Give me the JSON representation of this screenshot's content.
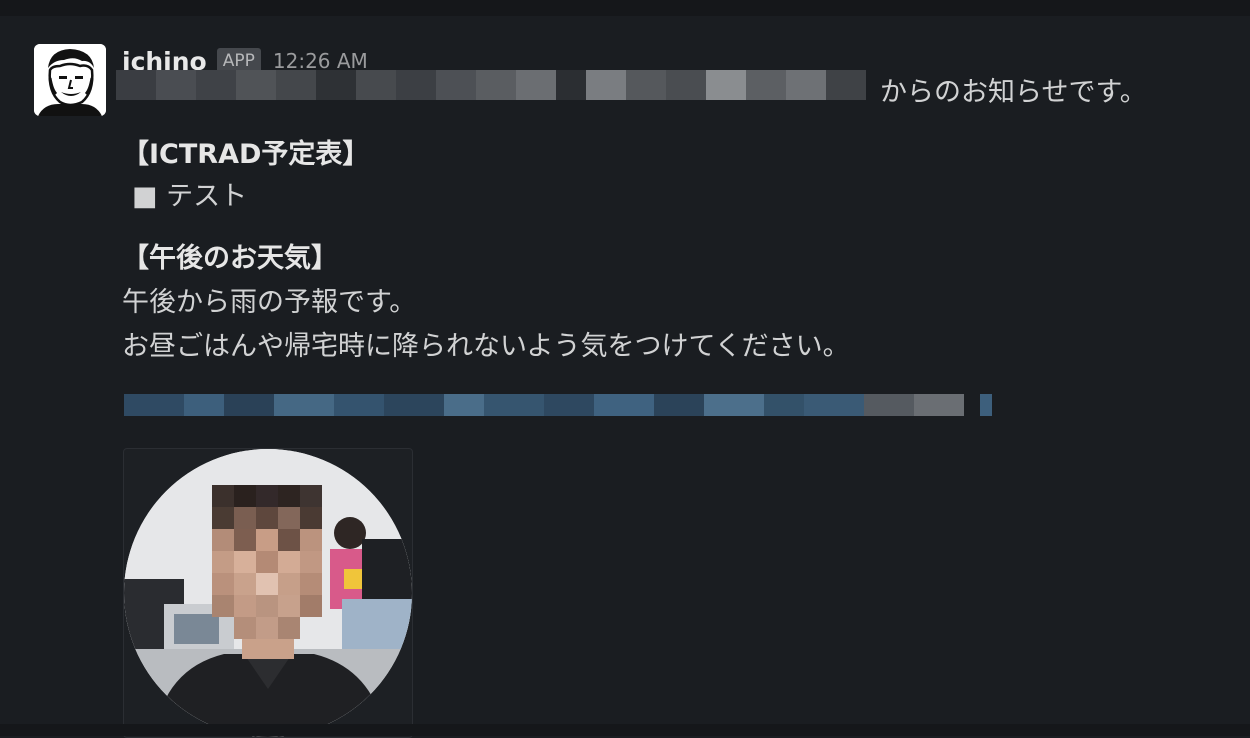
{
  "message": {
    "sender": "ichino",
    "badge": "APP",
    "timestamp": "12:26 AM",
    "intro_suffix": "からのお知らせです。",
    "schedule_heading": "【ICTRAD予定表】",
    "schedule_item": "■ テスト",
    "weather_heading": "【午後のお天気】",
    "weather_line1": "午後から雨の予報です。",
    "weather_line2": "お昼ごはんや帰宅時に降られないよう気をつけてください。"
  },
  "icons": {
    "avatar": "sender-avatar-portrait",
    "attachment": "circular-profile-photo"
  },
  "colors": {
    "background": "#1a1d21",
    "text": "#d1d2d3",
    "link_redacted": "#3d5f7c",
    "badge_bg": "#45484d"
  }
}
